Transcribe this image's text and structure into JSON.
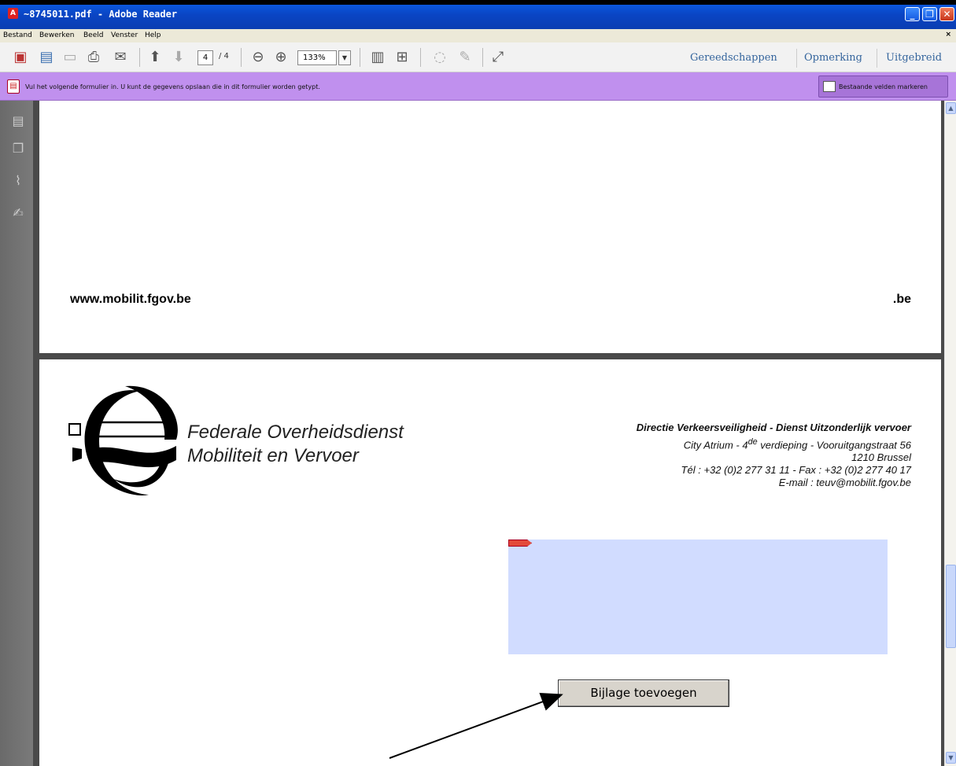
{
  "window": {
    "title": "~8745011.pdf - Adobe Reader",
    "app_icon": "pdf-icon",
    "buttons": [
      "minimize",
      "restore",
      "close"
    ]
  },
  "menu": {
    "items": [
      "Bestand",
      "Bewerken",
      "Beeld",
      "Venster",
      "Help"
    ],
    "close_glyph": "×"
  },
  "toolbar": {
    "page_current": "4",
    "page_total": "/ 4",
    "zoom": "133%",
    "right_tabs": [
      "Gereedschappen",
      "Opmerking",
      "Uitgebreid"
    ]
  },
  "formbar": {
    "message": "Vul het volgende formulier in. U kunt de gegevens opslaan die in dit formulier worden getypt.",
    "highlight_button": "Bestaande velden markeren"
  },
  "page1": {
    "url_left": "www.mobilit.fgov.be",
    "url_right": ".be"
  },
  "page2": {
    "org_line1": "Federale Overheidsdienst",
    "org_line2": "Mobiliteit en Vervoer",
    "contact": {
      "directie": "Directie Verkeersveiligheid - Dienst Uitzonderlijk vervoer",
      "address_prefix": "City Atrium  - 4",
      "address_sup": "de",
      "address_suffix": " verdieping - Vooruitgangstraat 56",
      "city": "1210 Brussel",
      "phone": "Tél : +32 (0)2 277 31 11 - Fax : +32 (0)2 277 40 17",
      "email": "E-mail : teuv@mobilit.fgov.be"
    },
    "add_attachment_button": "Bijlage toevoegen"
  },
  "colors": {
    "titlebar": "#0a45c4",
    "formbar": "#c090ee",
    "field_fill": "#d1dcff"
  }
}
